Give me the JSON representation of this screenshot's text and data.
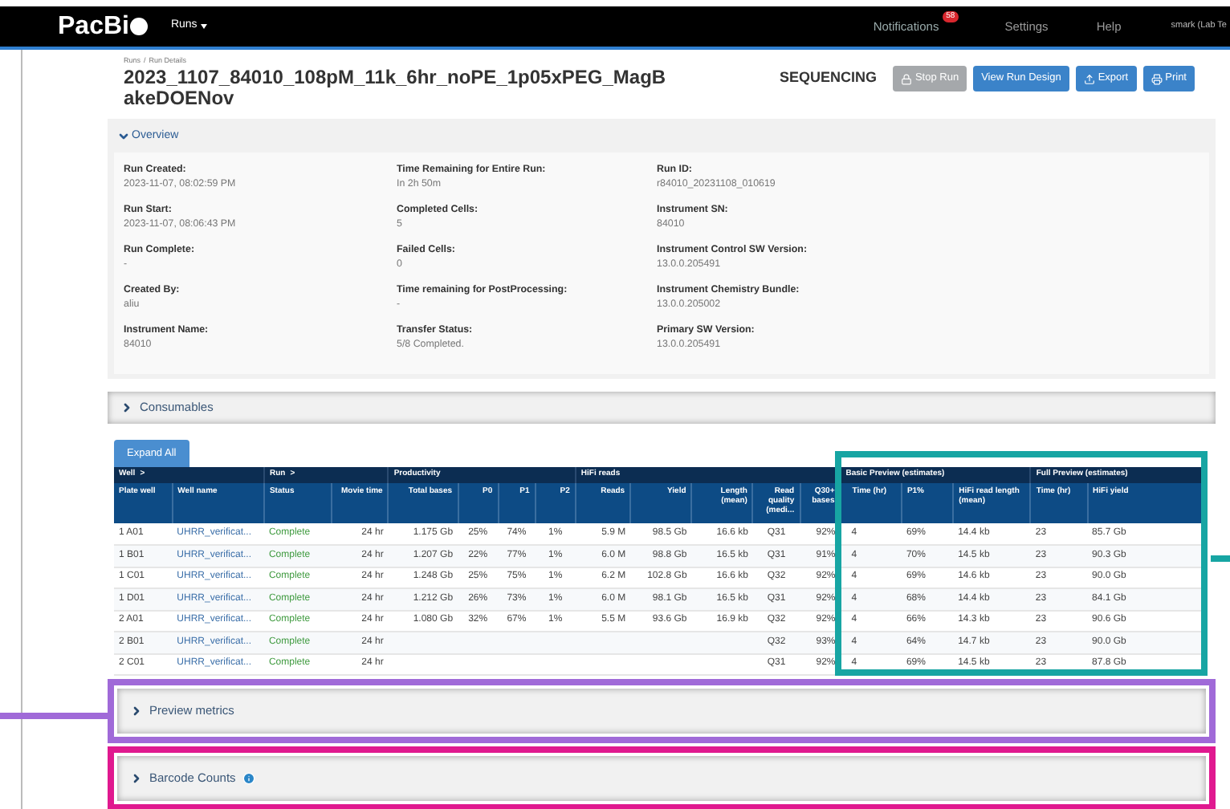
{
  "navbar": {
    "logo": "PacBi",
    "menu": "Runs",
    "notifications": {
      "label": "Notifications",
      "badge": "58"
    },
    "links": [
      "Settings",
      "Help"
    ],
    "user": "smark (Lab Te"
  },
  "breadcrumb": [
    "Runs",
    "Run Details"
  ],
  "breadcrumb_separator": "/",
  "title": "2023_1107_84010_108pM_11k_6hr_noPE_1p05xPEG_MagBakeDOENov",
  "status": "SEQUENCING",
  "buttons": [
    {
      "label": "Stop Run",
      "kind": "stop",
      "disabled": true
    },
    {
      "label": "View Run Design",
      "kind": "plain",
      "disabled": false
    },
    {
      "label": "Export",
      "kind": "export",
      "disabled": false
    },
    {
      "label": "Print",
      "kind": "print",
      "disabled": false
    }
  ],
  "overview": {
    "title": "Overview",
    "expanded": true,
    "columns": [
      [
        {
          "label": "Run Created:",
          "value": "2023-11-07, 08:02:59 PM"
        },
        {
          "label": "Run Start:",
          "value": "2023-11-07, 08:06:43 PM"
        },
        {
          "label": "Run Complete:",
          "value": "-"
        },
        {
          "label": "Created By:",
          "value": "aliu"
        },
        {
          "label": "Instrument Name:",
          "value": "84010"
        }
      ],
      [
        {
          "label": "Time Remaining for Entire Run:",
          "value": "In 2h 50m"
        },
        {
          "label": "Completed Cells:",
          "value": "5"
        },
        {
          "label": "Failed Cells:",
          "value": "0"
        },
        {
          "label": "Time remaining for PostProcessing:",
          "value": "-"
        },
        {
          "label": "Transfer Status:",
          "value": "5/8 Completed."
        }
      ],
      [
        {
          "label": "Run ID:",
          "value": "r84010_20231108_010619"
        },
        {
          "label": "Instrument SN:",
          "value": "84010"
        },
        {
          "label": "Instrument Control SW Version:",
          "value": "13.0.0.205491"
        },
        {
          "label": "Instrument Chemistry Bundle:",
          "value": "13.0.0.205002"
        },
        {
          "label": "Primary SW Version:",
          "value": "13.0.0.205491"
        }
      ]
    ]
  },
  "consumables": {
    "title": "Consumables",
    "expanded": false
  },
  "expand_all": "Expand All",
  "table": {
    "groups": [
      {
        "label": "Well",
        "marker": ">",
        "columns": [
          "Plate well",
          "Well name"
        ]
      },
      {
        "label": "Run",
        "marker": ">",
        "columns": [
          "Status",
          "Movie time"
        ]
      },
      {
        "label": "Productivity",
        "columns": [
          "Total bases",
          "P0",
          "P1",
          "P2"
        ]
      },
      {
        "label": "HiFi reads",
        "columns": [
          "Reads",
          "Yield",
          "Length (mean)",
          "Read quality (medi...",
          "Q30+ bases"
        ]
      },
      {
        "label": "Basic Preview (estimates)",
        "columns": [
          "Time (hr)",
          "P1%",
          "HiFi read length (mean)"
        ]
      },
      {
        "label": "Full Preview (estimates)",
        "columns": [
          "Time (hr)",
          "HiFi yield"
        ]
      }
    ],
    "rows": [
      [
        "1 A01",
        "UHRR_verificat...",
        "Complete",
        "24 hr",
        "1.175 Gb",
        "25%",
        "74%",
        "1%",
        "5.9 M",
        "98.5 Gb",
        "16.6 kb",
        "Q31",
        "92%",
        "4",
        "69%",
        "14.4 kb",
        "23",
        "85.7 Gb"
      ],
      [
        "1 B01",
        "UHRR_verificat...",
        "Complete",
        "24 hr",
        "1.207 Gb",
        "22%",
        "77%",
        "1%",
        "6.0 M",
        "98.8 Gb",
        "16.5 kb",
        "Q31",
        "91%",
        "4",
        "70%",
        "14.5 kb",
        "23",
        "90.3 Gb"
      ],
      [
        "1 C01",
        "UHRR_verificat...",
        "Complete",
        "24 hr",
        "1.248 Gb",
        "25%",
        "75%",
        "1%",
        "6.2 M",
        "102.8 Gb",
        "16.6 kb",
        "Q32",
        "92%",
        "4",
        "69%",
        "14.6 kb",
        "23",
        "90.0 Gb"
      ],
      [
        "1 D01",
        "UHRR_verificat...",
        "Complete",
        "24 hr",
        "1.212 Gb",
        "26%",
        "73%",
        "1%",
        "6.0 M",
        "98.1 Gb",
        "16.5 kb",
        "Q31",
        "92%",
        "4",
        "68%",
        "14.4 kb",
        "23",
        "84.1 Gb"
      ],
      [
        "2 A01",
        "UHRR_verificat...",
        "Complete",
        "24 hr",
        "1.080 Gb",
        "32%",
        "67%",
        "1%",
        "5.5 M",
        "93.6 Gb",
        "16.9 kb",
        "Q32",
        "92%",
        "4",
        "66%",
        "14.3 kb",
        "23",
        "90.6 Gb"
      ],
      [
        "2 B01",
        "UHRR_verificat...",
        "Complete",
        "24 hr",
        null,
        null,
        null,
        null,
        null,
        null,
        null,
        "Q32",
        "93%",
        "4",
        "64%",
        "14.7 kb",
        "23",
        "90.0 Gb"
      ],
      [
        "2 C01",
        "UHRR_verificat...",
        "Complete",
        "24 hr",
        null,
        null,
        null,
        null,
        null,
        null,
        null,
        "Q31",
        "92%",
        "4",
        "69%",
        "14.5 kb",
        "23",
        "87.8 Gb"
      ]
    ]
  },
  "preview_metrics": {
    "title": "Preview metrics",
    "expanded": false
  },
  "barcode_counts": {
    "title": "Barcode Counts",
    "expanded": false,
    "info": true
  }
}
